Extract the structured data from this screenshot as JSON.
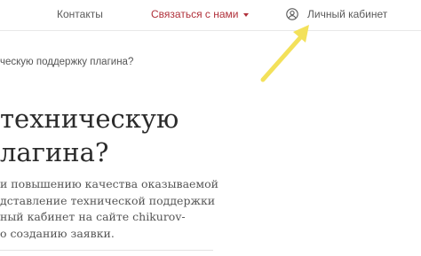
{
  "nav": {
    "contacts": "Контакты",
    "contact_us": "Связаться с нами",
    "cabinet": "Личный кабинет",
    "contact_us_color": "#b0303a"
  },
  "icons": {
    "caret": "chevron-down-icon",
    "user": "user-circle-icon",
    "annotation": "arrow-annotation",
    "annotation_color": "#f3e15a"
  },
  "breadcrumb": "ческую поддержку плагина?",
  "title": {
    "line1": "техническую",
    "line2": "лагина?"
  },
  "intro": {
    "line1": "и повышению качества оказываемой",
    "line2": "дставление технической поддержки",
    "line3": "ный кабинет на сайте chikurov-",
    "line4": "о созданию заявки."
  }
}
